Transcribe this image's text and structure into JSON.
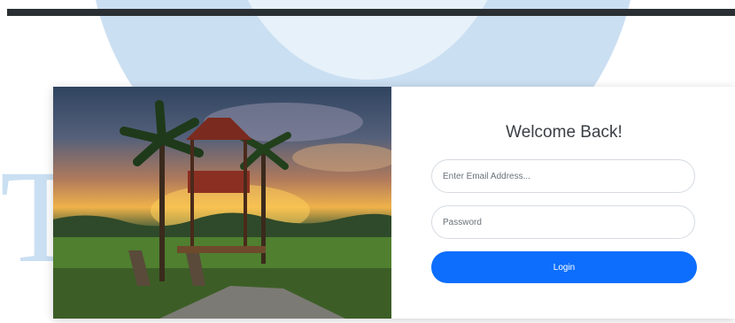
{
  "login": {
    "title": "Welcome Back!",
    "email_placeholder": "Enter Email Address...",
    "password_placeholder": "Password",
    "login_label": "Login"
  },
  "theme": {
    "accent": "#0d6efd",
    "top_bar": "#2a2f33",
    "watermark": "#b9d4ee"
  },
  "watermark": {
    "letters": "T  NE"
  }
}
